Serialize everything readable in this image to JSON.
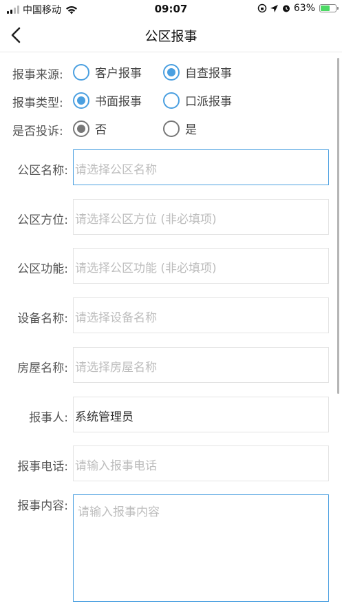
{
  "status_bar": {
    "carrier": "中国移动",
    "time": "09:07",
    "battery_percent": "63%",
    "battery_level": 0.63
  },
  "nav": {
    "title": "公区报事",
    "back_icon": "chevron-left-icon"
  },
  "radio_groups": [
    {
      "label": "报事来源:",
      "options": [
        "客户报事",
        "自查报事"
      ],
      "selected": 1
    },
    {
      "label": "报事类型:",
      "options": [
        "书面报事",
        "口派报事"
      ],
      "selected": 0
    },
    {
      "label": "是否投诉:",
      "options": [
        "否",
        "是"
      ],
      "selected": 0
    }
  ],
  "fields": [
    {
      "label": "公区名称:",
      "placeholder": "请选择公区名称",
      "value": ""
    },
    {
      "label": "公区方位:",
      "placeholder": "请选择公区方位 (非必填项)",
      "value": ""
    },
    {
      "label": "公区功能:",
      "placeholder": "请选择公区功能 (非必填项)",
      "value": ""
    },
    {
      "label": "设备名称:",
      "placeholder": "请选择设备名称",
      "value": ""
    },
    {
      "label": "房屋名称:",
      "placeholder": "请选择房屋名称",
      "value": ""
    },
    {
      "label": "报事人:",
      "placeholder": "",
      "value": "系统管理员"
    },
    {
      "label": "报事电话:",
      "placeholder": "请输入报事电话",
      "value": ""
    }
  ],
  "content_field": {
    "label": "报事内容:",
    "placeholder": "请输入报事内容"
  },
  "colors": {
    "accent": "#4a9fe0",
    "placeholder": "#bdbdbd",
    "label": "#555555"
  }
}
